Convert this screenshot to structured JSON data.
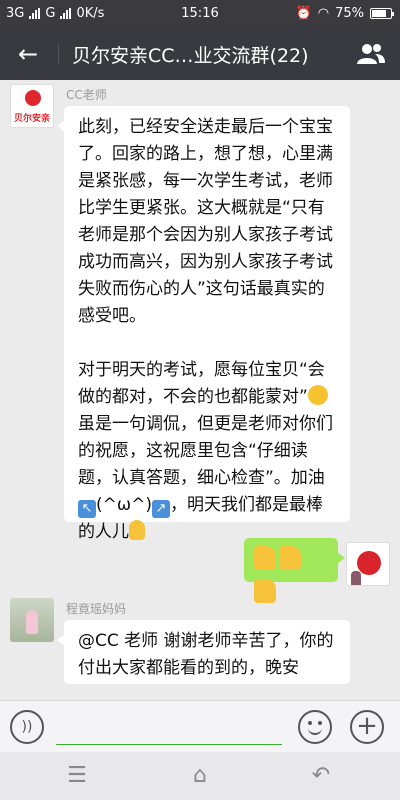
{
  "status_bar": {
    "network": "3G",
    "network2": "G",
    "speed": "0K/s",
    "time": "15:16",
    "battery": "75%"
  },
  "header": {
    "back_icon": "arrow-left-icon",
    "title": "贝尔安亲CC…业交流群(22)",
    "group_icon": "group-members-icon"
  },
  "messages": [
    {
      "sender": "CC老师",
      "avatar_text": "贝尔安亲",
      "paragraph1": "此刻，已经安全送走最后一个宝宝了。回家的路上，想了想，心里满是紧张感，每一次学生考试，老师比学生更紧张。这大概就是“只有老师是那个会因为别人家孩子考试成功而高兴，因为别人家孩子考试失败而伤心的人”这句话最真实的感受吧。",
      "paragraph2_a": "对于明天的考试，愿每位宝贝“会做的都对，不会的也都能蒙对”",
      "paragraph2_b": "虽是一句调侃，但更是老师对你们的祝愿，这祝愿里包含“仔细读题，认真答题，细心检查”。加油",
      "kaomoji": "(^ω^)",
      "paragraph2_c": "，明天我们都是最棒的人儿"
    },
    {
      "sender": "self",
      "content": "thumbs-up x3"
    },
    {
      "sender": "程竟瑶妈妈",
      "text": "@CC 老师  谢谢老师辛苦了，你的付出大家都能看的到的，晚安"
    }
  ],
  "input_bar": {
    "voice_icon": "voice-icon",
    "emoji_icon": "emoji-icon",
    "plus_icon": "plus-icon"
  },
  "nav_bar": {
    "menu_icon": "menu-icon",
    "home_icon": "home-icon",
    "back_icon": "back-icon"
  },
  "colors": {
    "header_bg": "#393a3f",
    "chat_bg": "#ebebeb",
    "self_bubble": "#a0e75a",
    "brand_red": "#e0272e"
  }
}
